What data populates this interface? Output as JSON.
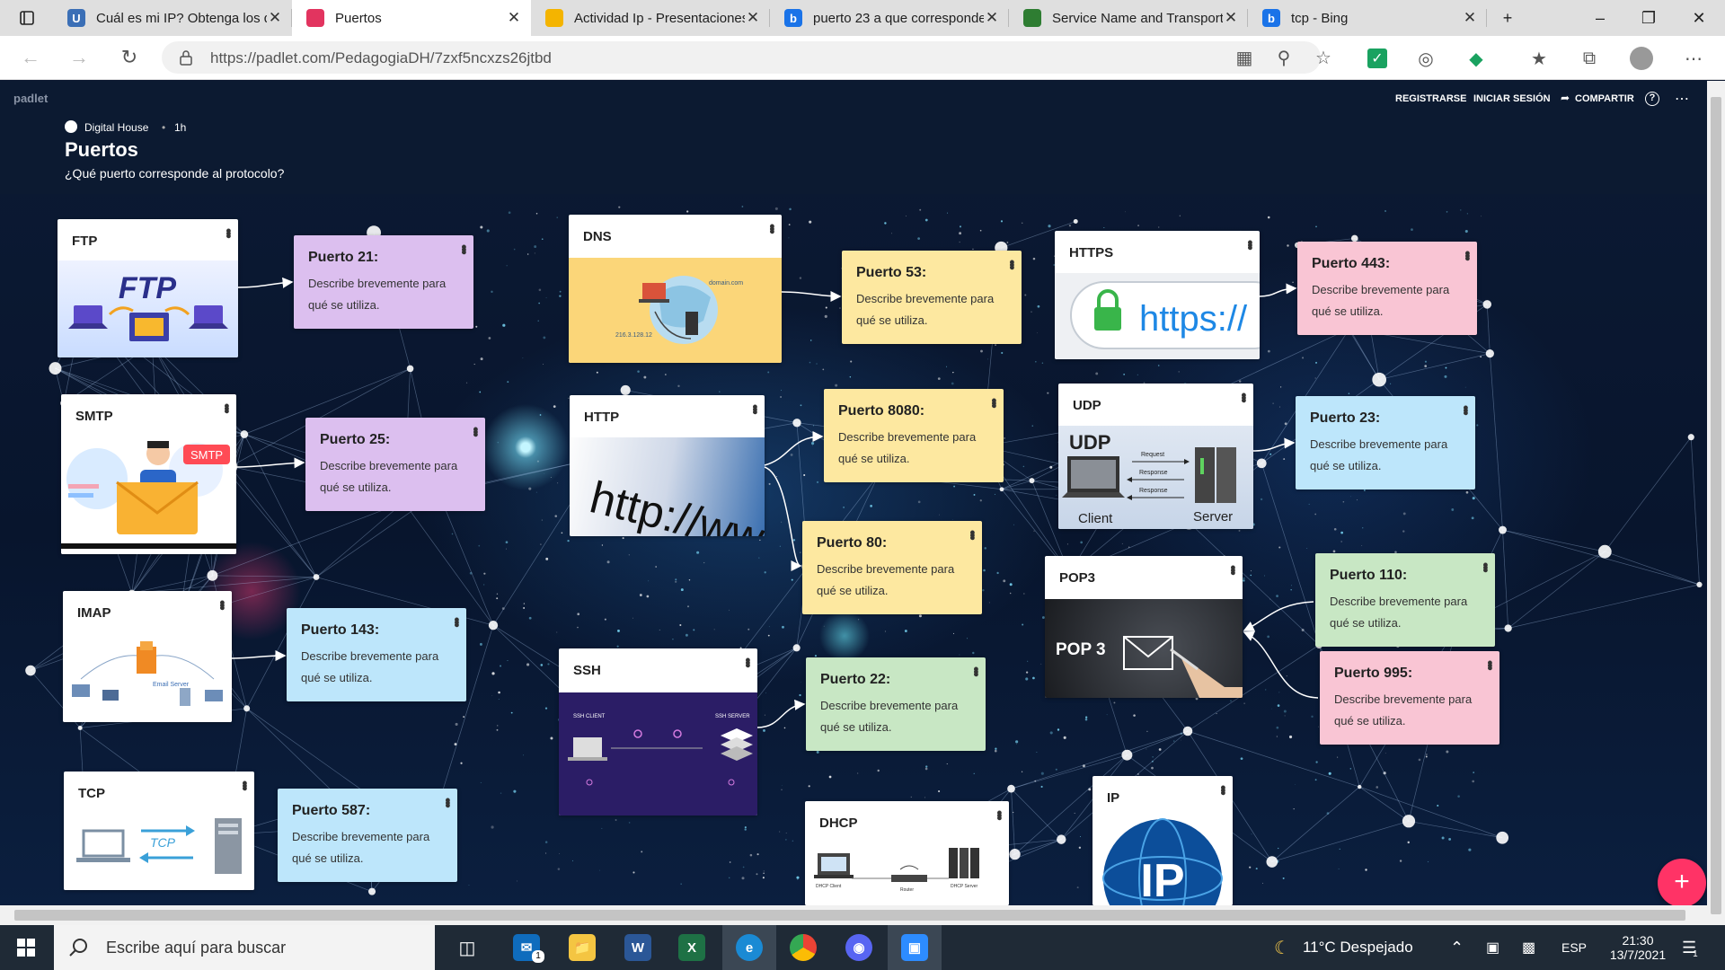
{
  "browser": {
    "tabs": [
      {
        "title": "Cuál es mi IP? Obtenga los detalles",
        "fav": "U",
        "color": "#3b6fb6"
      },
      {
        "title": "Puertos",
        "fav": "",
        "color": "#e2345f",
        "active": true
      },
      {
        "title": "Actividad Ip - Presentaciones",
        "fav": "",
        "color": "#f4b400"
      },
      {
        "title": "puerto 23 a que corresponde",
        "fav": "b",
        "color": "#1a73e8"
      },
      {
        "title": "Service Name and Transport",
        "fav": "",
        "color": "#2e7d32"
      },
      {
        "title": "tcp - Bing",
        "fav": "b",
        "color": "#1a73e8"
      }
    ],
    "url": "https://padlet.com/PedagogiaDH/7zxf5ncxzs26jtbd"
  },
  "padlet": {
    "brand": "padlet",
    "author": "Digital House",
    "time": "1h",
    "title": "Puertos",
    "subtitle": "¿Qué puerto corresponde al protocolo?",
    "actions": {
      "register": "REGISTRARSE",
      "login": "INICIAR SESIÓN",
      "share": "COMPARTIR"
    },
    "images": {
      "ftp": "FTP",
      "smtp": "SMTP",
      "udp": "UDP",
      "udp_client": "Client",
      "udp_server": "Server",
      "udp_request": "Request",
      "udp_response": "Response",
      "udp_response2": "Response",
      "pop3": "POP 3",
      "tcp": "TCP",
      "ip": "IP",
      "https": "https://",
      "http": "http://www",
      "dns_domain": "domain.com",
      "dns_ip": "216.3.128.12",
      "ssh_client": "SSH CLIENT",
      "ssh_server": "SSH SERVER",
      "imap_server": "Email Server",
      "dhcp_client": "DHCP Client",
      "dhcp_router": "Router",
      "dhcp_server": "DHCP Server"
    },
    "cards": {
      "ftp": "FTP",
      "smtp": "SMTP",
      "imap": "IMAP",
      "tcp": "TCP",
      "dns": "DNS",
      "http": "HTTP",
      "ssh": "SSH",
      "dhcp": "DHCP",
      "https": "HTTPS",
      "udp": "UDP",
      "pop3": "POP3",
      "ip": "IP"
    },
    "notes": {
      "p21": "Puerto 21:",
      "p25": "Puerto 25:",
      "p143": "Puerto 143:",
      "p587": "Puerto 587:",
      "p53": "Puerto 53:",
      "p8080": "Puerto 8080:",
      "p80": "Puerto 80:",
      "p22": "Puerto 22:",
      "p443": "Puerto 443:",
      "p23": "Puerto 23:",
      "p110": "Puerto 110:",
      "p995": "Puerto 995:"
    },
    "note_body": "Describe brevemente para qué se utiliza.",
    "add_button": "+"
  },
  "taskbar": {
    "search_placeholder": "Escribe aquí para buscar",
    "weather": "11°C  Despejado",
    "lang": "ESP",
    "time": "21:30",
    "date": "13/7/2021",
    "mail_badge": "1",
    "notif_badge": "1"
  }
}
